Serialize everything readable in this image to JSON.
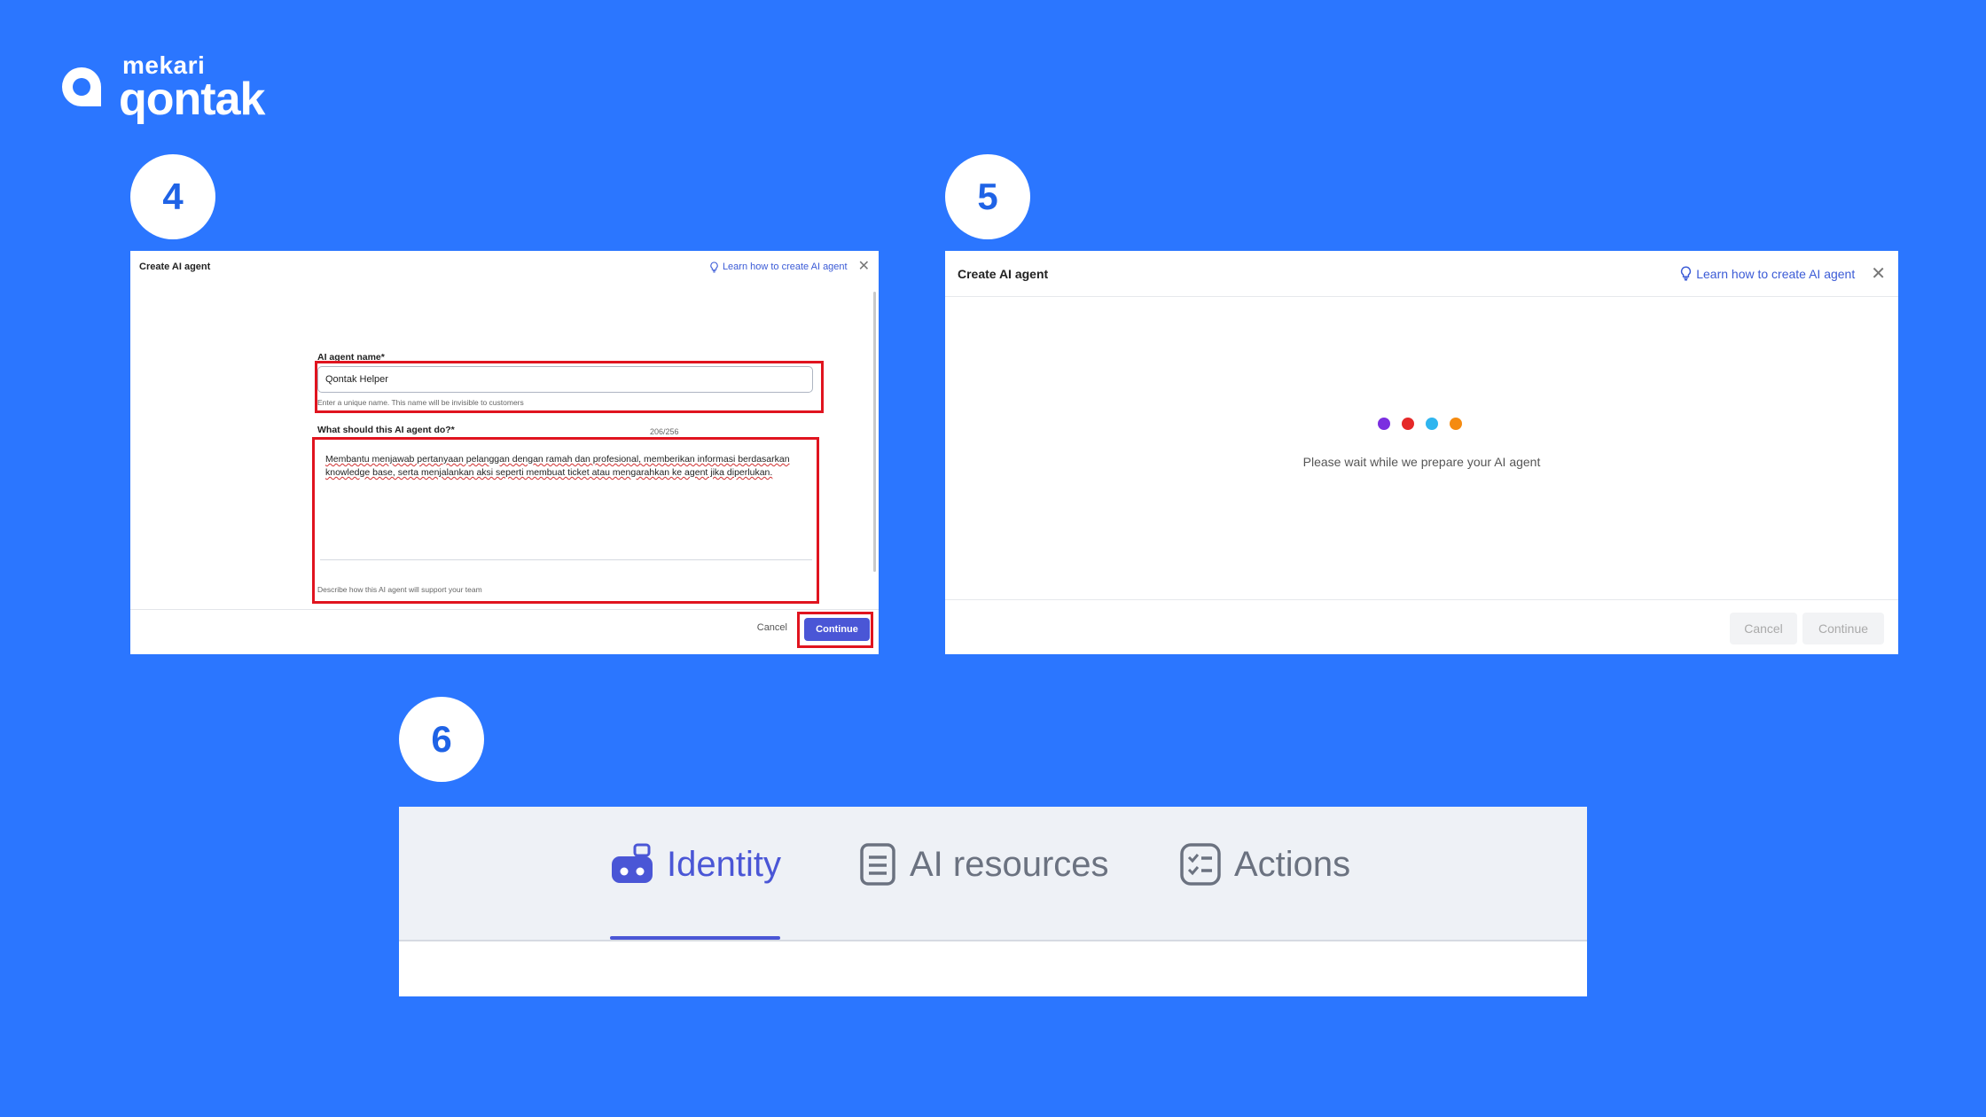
{
  "brand": {
    "small": "mekari",
    "big": "qontak"
  },
  "steps": {
    "s4": "4",
    "s5": "5",
    "s6": "6"
  },
  "panel4": {
    "title": "Create AI agent",
    "learn_link": "Learn how to create AI agent",
    "name_label": "AI agent name*",
    "name_value": "Qontak Helper",
    "name_hint": "Enter a unique name. This name will be invisible to customers",
    "task_label": "What should this AI agent do?*",
    "task_counter": "206/256",
    "task_value": "Membantu menjawab pertanyaan pelanggan dengan ramah dan profesional, memberikan informasi berdasarkan knowledge base, serta menjalankan aksi seperti membuat ticket atau mengarahkan ke agent jika diperlukan.",
    "task_hint": "Describe how this AI agent will support your team",
    "cancel": "Cancel",
    "continue": "Continue"
  },
  "panel5": {
    "title": "Create AI agent",
    "learn_link": "Learn how to create AI agent",
    "wait_text": "Please wait while we prepare your AI agent",
    "dot_colors": [
      "#7b2fe0",
      "#e52828",
      "#2fb5ef",
      "#f58b10"
    ],
    "cancel": "Cancel",
    "continue": "Continue"
  },
  "panel6": {
    "tabs": [
      {
        "label": "Identity",
        "icon": "robot-icon",
        "active": true
      },
      {
        "label": "AI resources",
        "icon": "document-icon",
        "active": false
      },
      {
        "label": "Actions",
        "icon": "checklist-icon",
        "active": false
      }
    ]
  },
  "colors": {
    "background": "#2b76ff",
    "accent": "#4a56d6",
    "highlight": "#e0141f"
  }
}
